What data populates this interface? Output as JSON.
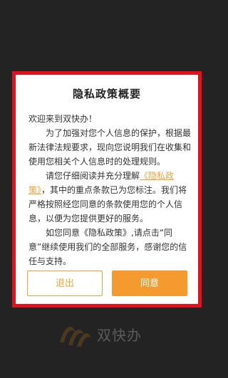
{
  "dialog": {
    "title": "隐私政策概要",
    "greeting": "欢迎来到双快办！",
    "paragraph1": "为了加强对您个人信息的保护，根据最新法律法规要求，现向您说明我们在收集和使用您相关个人信息时的处理规则。",
    "paragraph2_prefix": "请您仔细阅读并充分理解",
    "policy_link": "《隐私政策》",
    "paragraph2_suffix": "，其中的重点条款已为您标注。我们将严格按照经您同意的条款使用您的个人信息，以便为您提供更好的服务。",
    "paragraph3": "如您同意《隐私政策》,请点击“同意”继续使用我们的全部服务，感谢您的信任与支持。",
    "exit_label": "退出",
    "agree_label": "同意"
  },
  "background": {
    "app_name": "双快办"
  },
  "colors": {
    "frame_border": "#e5101b",
    "accent": "#f59a2e",
    "link": "#f0a23a",
    "page_background": "#232323"
  }
}
